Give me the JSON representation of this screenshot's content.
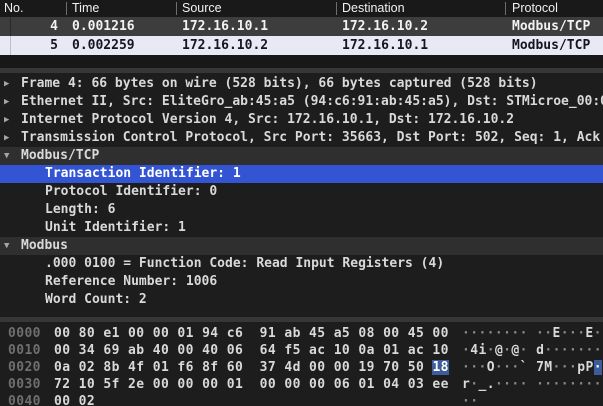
{
  "icons": {
    "collapsed": "▶",
    "expanded": "▼",
    "none": ""
  },
  "colors": {
    "selection_blue": "#3355d4",
    "hex_highlight_blue": "#3c5c9b",
    "selected_row_light": "#e9e9f6",
    "unselected_row_dark": "#3d3d3d",
    "pane_background": "#1d1d1d",
    "subheading_row": "#2f2f2f"
  },
  "packet_list": {
    "columns": [
      "No.",
      "Time",
      "Source",
      "Destination",
      "Protocol"
    ],
    "rows": [
      {
        "no": "4",
        "time": "0.001216",
        "source": "172.16.10.1",
        "destination": "172.16.10.2",
        "protocol": "Modbus/TCP",
        "selected": false
      },
      {
        "no": "5",
        "time": "0.002259",
        "source": "172.16.10.2",
        "destination": "172.16.10.1",
        "protocol": "Modbus/TCP",
        "selected": true
      }
    ]
  },
  "details_tree": {
    "rows": [
      {
        "arrow": "collapsed",
        "level": 0,
        "state": "normal",
        "text": "Frame 4: 66 bytes on wire (528 bits), 66 bytes captured (528 bits)"
      },
      {
        "arrow": "collapsed",
        "level": 0,
        "state": "normal",
        "text": "Ethernet II, Src: EliteGro_ab:45:a5 (94:c6:91:ab:45:a5), Dst: STMicroe_00:0"
      },
      {
        "arrow": "collapsed",
        "level": 0,
        "state": "normal",
        "text": "Internet Protocol Version 4, Src: 172.16.10.1, Dst: 172.16.10.2"
      },
      {
        "arrow": "collapsed",
        "level": 0,
        "state": "normal",
        "text": "Transmission Control Protocol, Src Port: 35663, Dst Port: 502, Seq: 1, Ack"
      },
      {
        "arrow": "expanded",
        "level": 0,
        "state": "subhead",
        "text": "Modbus/TCP"
      },
      {
        "arrow": "none",
        "level": 1,
        "state": "selected",
        "text": "Transaction Identifier: 1"
      },
      {
        "arrow": "none",
        "level": 1,
        "state": "normal",
        "text": "Protocol Identifier: 0"
      },
      {
        "arrow": "none",
        "level": 1,
        "state": "normal",
        "text": "Length: 6"
      },
      {
        "arrow": "none",
        "level": 1,
        "state": "normal",
        "text": "Unit Identifier: 1"
      },
      {
        "arrow": "expanded",
        "level": 0,
        "state": "subhead",
        "text": "Modbus"
      },
      {
        "arrow": "none",
        "level": 1,
        "state": "normal",
        "text": ".000 0100 = Function Code: Read Input Registers (4)"
      },
      {
        "arrow": "none",
        "level": 1,
        "state": "normal",
        "text": "Reference Number: 1006"
      },
      {
        "arrow": "none",
        "level": 1,
        "state": "normal",
        "text": "Word Count: 2"
      }
    ]
  },
  "hex_dump": {
    "rows": [
      {
        "offset": "0000",
        "hex": [
          {
            "t": "00 80 e1 00 00 01 94 c6  91 ab 45 a5 08 00 45 00",
            "s": "n"
          }
        ],
        "ascii": [
          {
            "t": "········ ··",
            "s": "dim"
          },
          {
            "t": "E",
            "s": "br"
          },
          {
            "t": "···",
            "s": "dim"
          },
          {
            "t": "E",
            "s": "br"
          },
          {
            "t": "·",
            "s": "dim"
          }
        ]
      },
      {
        "offset": "0010",
        "hex": [
          {
            "t": "00 34 69 ab 40 00 40 06  64 f5 ac 10 0a 01 ac 10",
            "s": "n"
          }
        ],
        "ascii": [
          {
            "t": "·",
            "s": "dim"
          },
          {
            "t": "4i",
            "s": "br"
          },
          {
            "t": "·",
            "s": "dim"
          },
          {
            "t": "@",
            "s": "br"
          },
          {
            "t": "·",
            "s": "dim"
          },
          {
            "t": "@",
            "s": "br"
          },
          {
            "t": "· ",
            "s": "dim"
          },
          {
            "t": "d",
            "s": "br"
          },
          {
            "t": "·······",
            "s": "dim"
          }
        ]
      },
      {
        "offset": "0020",
        "hex": [
          {
            "t": "0a 02 8b 4f 01 f6 8f 60  37 4d 00 00 19 70 50 ",
            "s": "n"
          },
          {
            "t": "18",
            "s": "hl"
          }
        ],
        "ascii": [
          {
            "t": "···",
            "s": "dim"
          },
          {
            "t": "O",
            "s": "br"
          },
          {
            "t": "···",
            "s": "dim"
          },
          {
            "t": "`",
            "s": "br"
          },
          {
            "t": " ",
            "s": "dim"
          },
          {
            "t": "7M",
            "s": "br"
          },
          {
            "t": "···",
            "s": "dim"
          },
          {
            "t": "pP",
            "s": "br"
          },
          {
            "t": "·",
            "s": "hl"
          }
        ]
      },
      {
        "offset": "0030",
        "hex": [
          {
            "t": "72 10 5f 2e 00 00 00 01  00 00 00 06 01 04 03 ee",
            "s": "n"
          }
        ],
        "ascii": [
          {
            "t": "r",
            "s": "br"
          },
          {
            "t": "·",
            "s": "dim"
          },
          {
            "t": "_.",
            "s": "br"
          },
          {
            "t": "···· ········",
            "s": "dim"
          }
        ]
      },
      {
        "offset": "0040",
        "hex": [
          {
            "t": "00 02",
            "s": "n"
          }
        ],
        "ascii": [
          {
            "t": "··",
            "s": "dim"
          }
        ]
      }
    ]
  }
}
